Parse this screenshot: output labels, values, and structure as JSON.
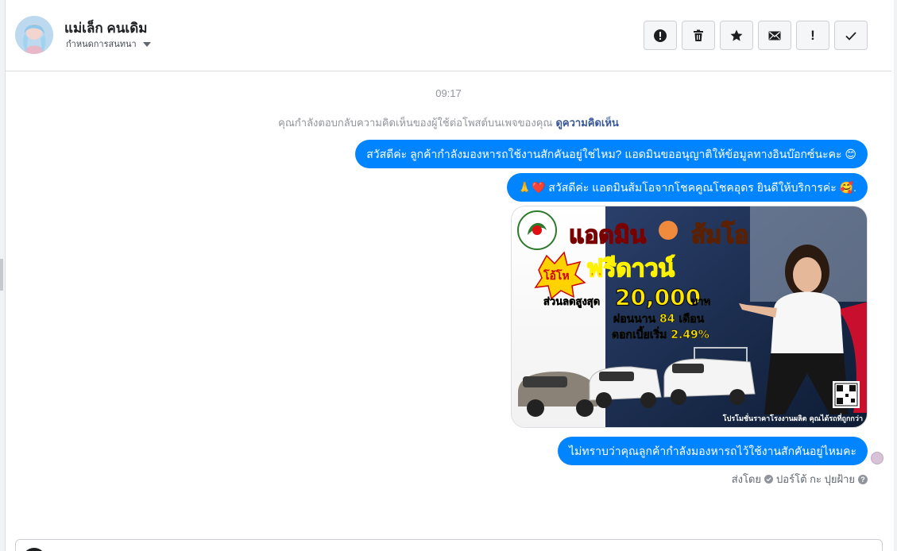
{
  "header": {
    "contact_name": "แม่เล็ก คนเดิม",
    "status_label": "กำหนดการสนทนา"
  },
  "toolbar": {
    "buttons": [
      {
        "name": "spam",
        "icon": "alert-circle-icon"
      },
      {
        "name": "delete",
        "icon": "trash-icon"
      },
      {
        "name": "star",
        "icon": "star-icon"
      },
      {
        "name": "unread",
        "icon": "envelope-icon"
      },
      {
        "name": "priority",
        "icon": "exclamation-icon",
        "glyph": "!"
      },
      {
        "name": "done",
        "icon": "check-icon"
      }
    ]
  },
  "thread": {
    "time": "09:17",
    "reply_note": "คุณกำลังตอบกลับความคิดเห็นของผู้ใช้ต่อโพสต์บนเพจของคุณ",
    "reply_link": "ดูความคิดเห็น",
    "messages": [
      {
        "text": "สวัสดีค่ะ ลูกค้ากำลังมองหารถใช้งานสักคันอยู่ใช่ไหม? แอดมินขออนุญาติให้ข้อมูลทางอินบ๊อกซ์นะคะ 😊"
      },
      {
        "text": "🙏❤️ สวัสดีค่ะ แอดมินส้มโอจากโชคคูณโชคอุดร ยินดีให้บริการค่ะ 🥰."
      },
      {
        "text": "ไม่ทราบว่าคุณลูกค้ากำลังมองหารถไว้ใช้งานสักคันอยู่ไหมคะ"
      }
    ],
    "promo": {
      "headline": "แอดมิน",
      "headline_name": "ส้มโอ",
      "badge": "โอ้โห",
      "free_down": "ฟรีดาวน์",
      "discount_label": "ส่วนลดสูงสุด",
      "discount_amount": "20,000",
      "discount_unit": "บาท",
      "installment": "ผ่อนนาน 84 เดือน",
      "interest": "ดอกเบี้ยเริ่ม 2.49%",
      "footer": "โปรโมชั่นราคาโรงงานผลิต คุณได้รถที่ถูกกว่า"
    },
    "sent_by_label": "ส่งโดย",
    "sent_by_name": "ปอร์โต้ กะ ปุยฝ้าย"
  },
  "colors": {
    "bubble": "#0084ff",
    "link": "#385898",
    "muted": "#90949c"
  }
}
